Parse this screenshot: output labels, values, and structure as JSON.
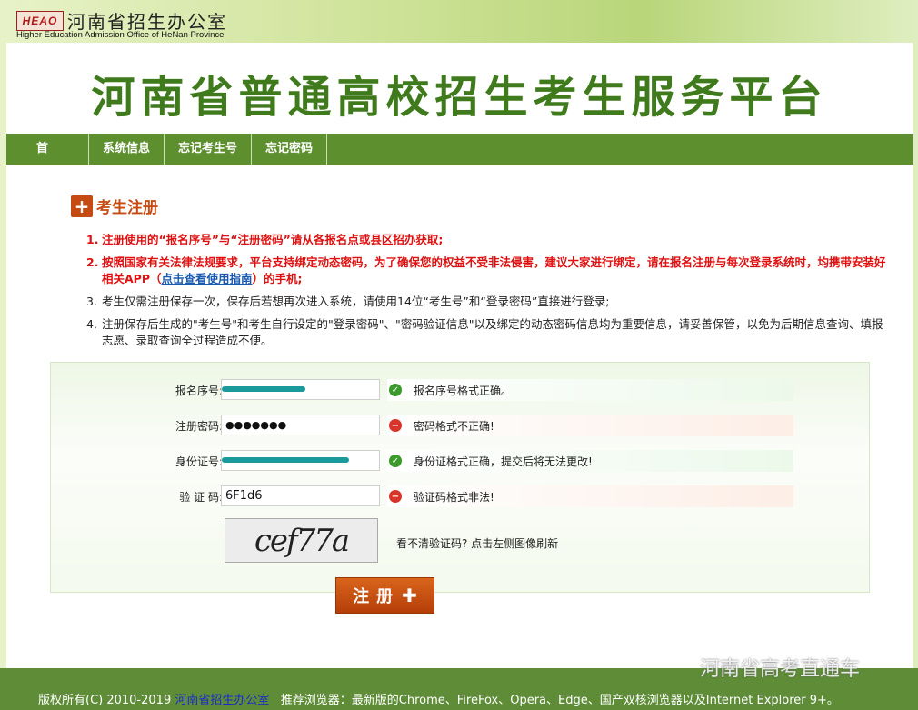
{
  "header": {
    "logo_mark": "HEAO",
    "org_cn": "河南省招生办公室",
    "org_en": "Higher Education Admission Office of HeNan Province",
    "title": "河南省普通高校招生考生服务平台"
  },
  "nav": [
    {
      "label": "首页"
    },
    {
      "label": "系统信息"
    },
    {
      "label": "忘记考生号"
    },
    {
      "label": "忘记密码"
    }
  ],
  "section": {
    "title": "考生注册"
  },
  "notes": [
    {
      "num": "1.",
      "text": "注册使用的“报名序号”与“注册密码”请从各报名点或县区招办获取;"
    },
    {
      "num": "2.",
      "text_before": "按照国家有关法律法规要求，平台支持绑定动态密码，为了确保您的权益不受非法侵害，建议大家进行绑定，请在报名注册与每次登录系统时，均携带安装好相关APP（",
      "link": "点击查看使用指南",
      "text_after": "）的手机;"
    },
    {
      "num": "3.",
      "text": "考生仅需注册保存一次，保存后若想再次进入系统，请使用14位“考生号”和“登录密码”直接进行登录;"
    },
    {
      "num": "4.",
      "text": "注册保存后生成的\"考生号\"和考生自行设定的\"登录密码\"、\"密码验证信息\"以及绑定的动态密码信息均为重要信息，请妥善保管，以免为后期信息查询、填报志愿、录取查询全过程造成不便。"
    }
  ],
  "form": {
    "fields": [
      {
        "label": "报名序号:",
        "value": "",
        "status": "ok",
        "message": "报名序号格式正确。"
      },
      {
        "label": "注册密码:",
        "value": "●●●●●●●",
        "status": "error",
        "message": "密码格式不正确!"
      },
      {
        "label": "身份证号:",
        "value": "",
        "status": "ok",
        "message": "身份证格式正确，提交后将无法更改!"
      },
      {
        "label": "验 证 码:",
        "value": "6F1d6",
        "status": "error",
        "message": "验证码格式非法!"
      }
    ],
    "captcha_text": "cef77a",
    "captcha_hint": "看不清验证码? 点击左侧图像刷新"
  },
  "register_button": {
    "label": "注册",
    "icon": "plus-icon"
  },
  "footer": {
    "copyright": "版权所有(C) 2010-2019",
    "org_link": "河南省招生办公室",
    "browsers": "推荐浏览器：最新版的Chrome、FireFox、Opera、Edge、国产双核浏览器以及Internet Explorer 9+。"
  },
  "watermark": "河南省高考直通车",
  "colors": {
    "brand_green": "#5d8f2f",
    "title_green": "#3f7a1c",
    "accent_orange": "#c64b12",
    "error_red": "#e01010",
    "link_blue": "#1a5ab0"
  }
}
